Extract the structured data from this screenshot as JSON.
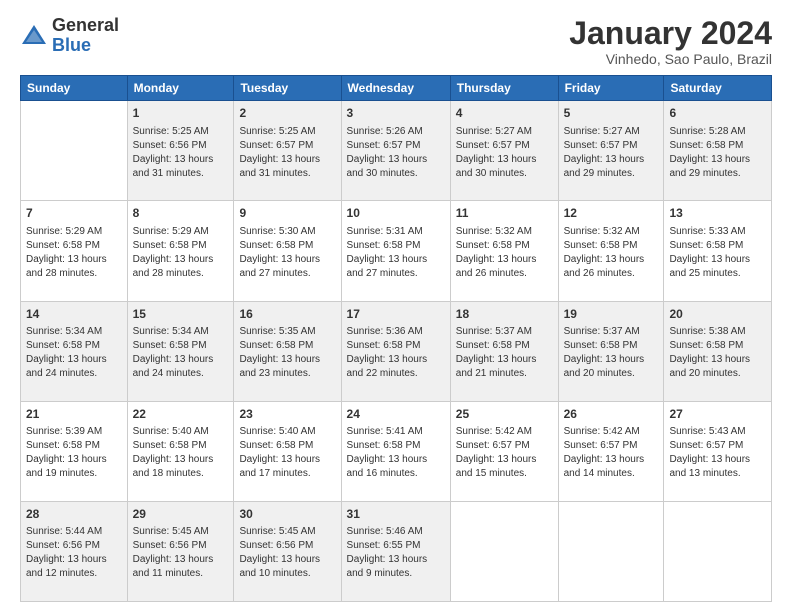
{
  "header": {
    "logo_general": "General",
    "logo_blue": "Blue",
    "month_title": "January 2024",
    "location": "Vinhedo, Sao Paulo, Brazil"
  },
  "weekdays": [
    "Sunday",
    "Monday",
    "Tuesday",
    "Wednesday",
    "Thursday",
    "Friday",
    "Saturday"
  ],
  "weeks": [
    [
      {
        "day": "",
        "info": ""
      },
      {
        "day": "1",
        "info": "Sunrise: 5:25 AM\nSunset: 6:56 PM\nDaylight: 13 hours\nand 31 minutes."
      },
      {
        "day": "2",
        "info": "Sunrise: 5:25 AM\nSunset: 6:57 PM\nDaylight: 13 hours\nand 31 minutes."
      },
      {
        "day": "3",
        "info": "Sunrise: 5:26 AM\nSunset: 6:57 PM\nDaylight: 13 hours\nand 30 minutes."
      },
      {
        "day": "4",
        "info": "Sunrise: 5:27 AM\nSunset: 6:57 PM\nDaylight: 13 hours\nand 30 minutes."
      },
      {
        "day": "5",
        "info": "Sunrise: 5:27 AM\nSunset: 6:57 PM\nDaylight: 13 hours\nand 29 minutes."
      },
      {
        "day": "6",
        "info": "Sunrise: 5:28 AM\nSunset: 6:58 PM\nDaylight: 13 hours\nand 29 minutes."
      }
    ],
    [
      {
        "day": "7",
        "info": "Sunrise: 5:29 AM\nSunset: 6:58 PM\nDaylight: 13 hours\nand 28 minutes."
      },
      {
        "day": "8",
        "info": "Sunrise: 5:29 AM\nSunset: 6:58 PM\nDaylight: 13 hours\nand 28 minutes."
      },
      {
        "day": "9",
        "info": "Sunrise: 5:30 AM\nSunset: 6:58 PM\nDaylight: 13 hours\nand 27 minutes."
      },
      {
        "day": "10",
        "info": "Sunrise: 5:31 AM\nSunset: 6:58 PM\nDaylight: 13 hours\nand 27 minutes."
      },
      {
        "day": "11",
        "info": "Sunrise: 5:32 AM\nSunset: 6:58 PM\nDaylight: 13 hours\nand 26 minutes."
      },
      {
        "day": "12",
        "info": "Sunrise: 5:32 AM\nSunset: 6:58 PM\nDaylight: 13 hours\nand 26 minutes."
      },
      {
        "day": "13",
        "info": "Sunrise: 5:33 AM\nSunset: 6:58 PM\nDaylight: 13 hours\nand 25 minutes."
      }
    ],
    [
      {
        "day": "14",
        "info": "Sunrise: 5:34 AM\nSunset: 6:58 PM\nDaylight: 13 hours\nand 24 minutes."
      },
      {
        "day": "15",
        "info": "Sunrise: 5:34 AM\nSunset: 6:58 PM\nDaylight: 13 hours\nand 24 minutes."
      },
      {
        "day": "16",
        "info": "Sunrise: 5:35 AM\nSunset: 6:58 PM\nDaylight: 13 hours\nand 23 minutes."
      },
      {
        "day": "17",
        "info": "Sunrise: 5:36 AM\nSunset: 6:58 PM\nDaylight: 13 hours\nand 22 minutes."
      },
      {
        "day": "18",
        "info": "Sunrise: 5:37 AM\nSunset: 6:58 PM\nDaylight: 13 hours\nand 21 minutes."
      },
      {
        "day": "19",
        "info": "Sunrise: 5:37 AM\nSunset: 6:58 PM\nDaylight: 13 hours\nand 20 minutes."
      },
      {
        "day": "20",
        "info": "Sunrise: 5:38 AM\nSunset: 6:58 PM\nDaylight: 13 hours\nand 20 minutes."
      }
    ],
    [
      {
        "day": "21",
        "info": "Sunrise: 5:39 AM\nSunset: 6:58 PM\nDaylight: 13 hours\nand 19 minutes."
      },
      {
        "day": "22",
        "info": "Sunrise: 5:40 AM\nSunset: 6:58 PM\nDaylight: 13 hours\nand 18 minutes."
      },
      {
        "day": "23",
        "info": "Sunrise: 5:40 AM\nSunset: 6:58 PM\nDaylight: 13 hours\nand 17 minutes."
      },
      {
        "day": "24",
        "info": "Sunrise: 5:41 AM\nSunset: 6:58 PM\nDaylight: 13 hours\nand 16 minutes."
      },
      {
        "day": "25",
        "info": "Sunrise: 5:42 AM\nSunset: 6:57 PM\nDaylight: 13 hours\nand 15 minutes."
      },
      {
        "day": "26",
        "info": "Sunrise: 5:42 AM\nSunset: 6:57 PM\nDaylight: 13 hours\nand 14 minutes."
      },
      {
        "day": "27",
        "info": "Sunrise: 5:43 AM\nSunset: 6:57 PM\nDaylight: 13 hours\nand 13 minutes."
      }
    ],
    [
      {
        "day": "28",
        "info": "Sunrise: 5:44 AM\nSunset: 6:56 PM\nDaylight: 13 hours\nand 12 minutes."
      },
      {
        "day": "29",
        "info": "Sunrise: 5:45 AM\nSunset: 6:56 PM\nDaylight: 13 hours\nand 11 minutes."
      },
      {
        "day": "30",
        "info": "Sunrise: 5:45 AM\nSunset: 6:56 PM\nDaylight: 13 hours\nand 10 minutes."
      },
      {
        "day": "31",
        "info": "Sunrise: 5:46 AM\nSunset: 6:55 PM\nDaylight: 13 hours\nand 9 minutes."
      },
      {
        "day": "",
        "info": ""
      },
      {
        "day": "",
        "info": ""
      },
      {
        "day": "",
        "info": ""
      }
    ]
  ]
}
